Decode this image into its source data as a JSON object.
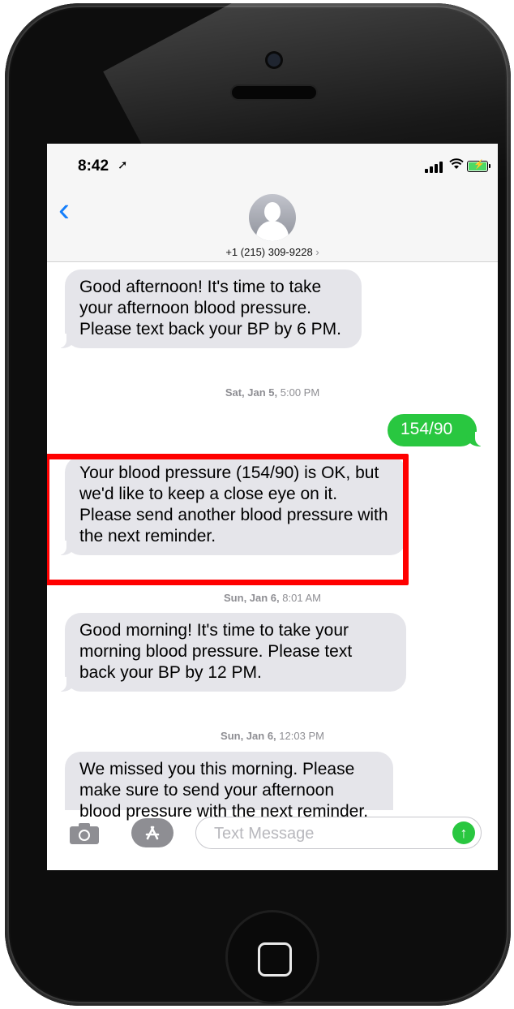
{
  "status_bar": {
    "time": "8:42",
    "location_icon": "location-arrow-icon",
    "signal_icon": "cellular-signal-icon",
    "wifi_icon": "wifi-icon",
    "battery_icon": "battery-charging-icon"
  },
  "header": {
    "back_icon": "chevron-left-icon",
    "avatar_icon": "person-silhouette-icon",
    "contact": "+1 (215) 309-9228",
    "contact_chevron": "›"
  },
  "messages": [
    {
      "type": "received",
      "text": "Good afternoon!  It's time to take your afternoon blood pressure.  Please text back your BP by 6 PM."
    },
    {
      "type": "timestamp",
      "day": "Sat, Jan 5,",
      "time": "5:00 PM"
    },
    {
      "type": "sent",
      "text": "154/90"
    },
    {
      "type": "received",
      "text": "Your blood pressure (154/90) is OK, but we'd like to keep a close eye on it. Please send another blood pressure with the next reminder.",
      "highlighted": true
    },
    {
      "type": "timestamp",
      "day": "Sun, Jan 6,",
      "time": "8:01 AM"
    },
    {
      "type": "received",
      "text": "Good morning!  It's time to take your morning blood pressure. Please text back your BP by 12 PM."
    },
    {
      "type": "timestamp",
      "day": "Sun, Jan 6,",
      "time": "12:03 PM"
    },
    {
      "type": "received",
      "text": "We missed you this morning. Please make sure to send your afternoon blood pressure with the next reminder."
    }
  ],
  "input_bar": {
    "camera_icon": "camera-icon",
    "apps_icon": "app-store-icon",
    "placeholder": "Text Message",
    "send_icon": "arrow-up-icon"
  },
  "colors": {
    "received_bubble": "#e5e5ea",
    "sent_bubble": "#29c740",
    "highlight_box": "#ff0000",
    "ios_blue": "#147efb"
  }
}
